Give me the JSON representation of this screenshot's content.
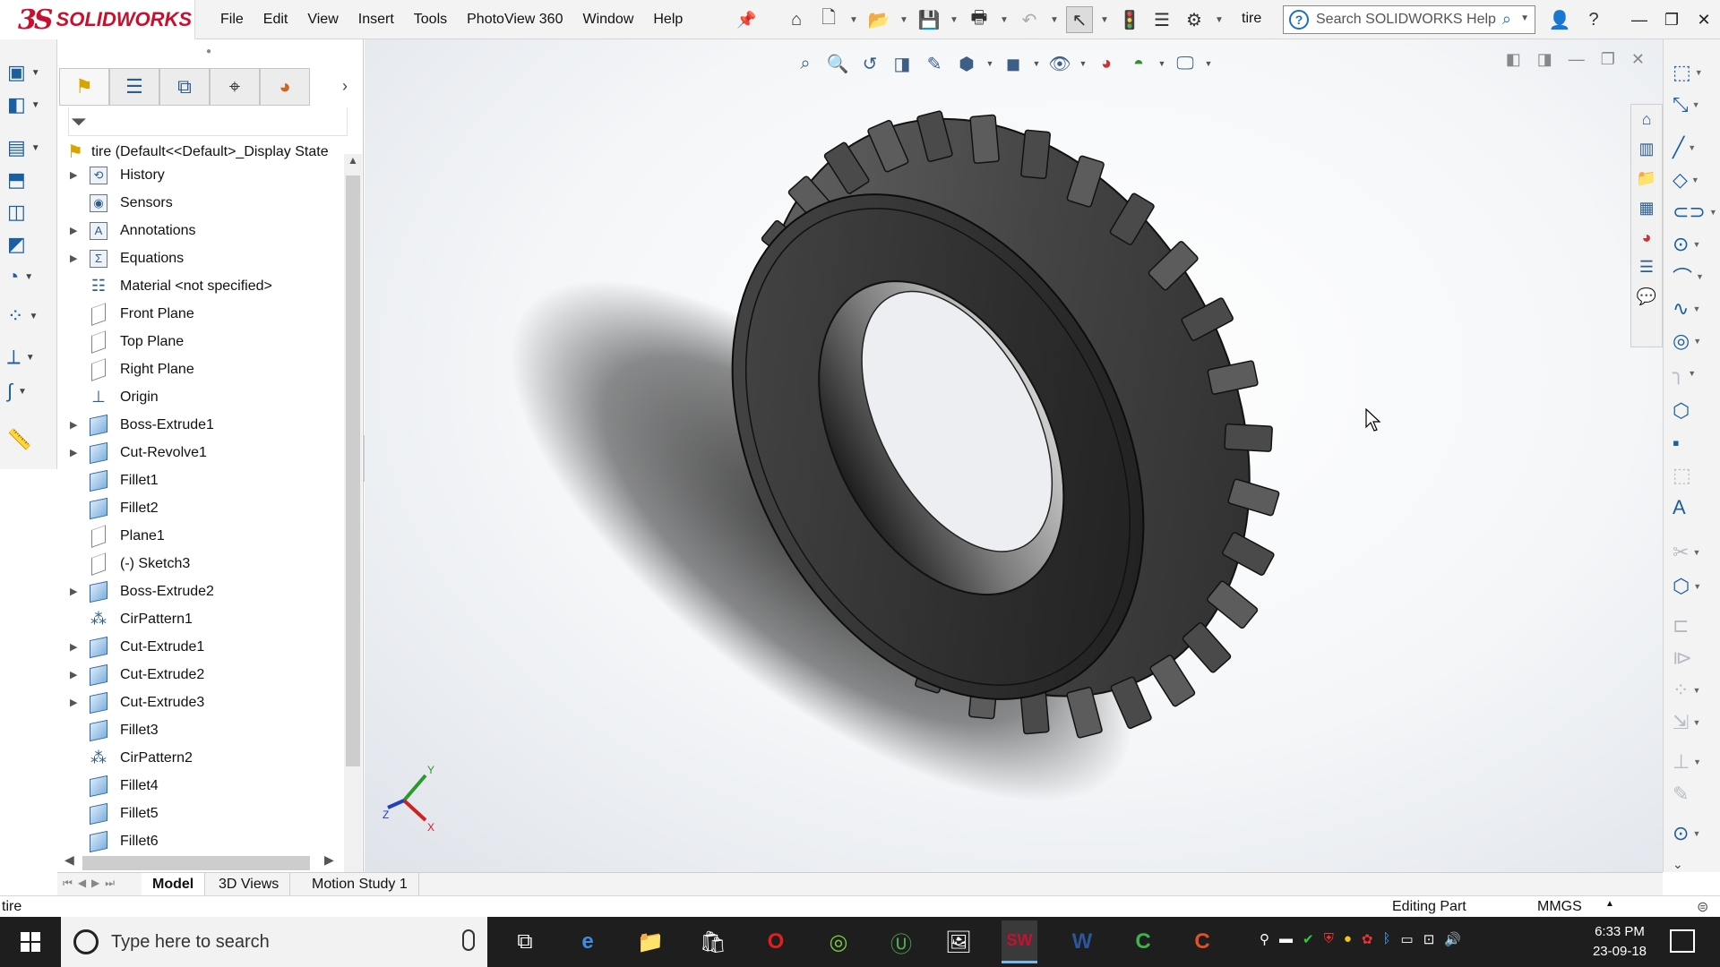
{
  "app": {
    "logo_ds": "3S",
    "logo_brand": "SOLIDWORKS",
    "menu": [
      "File",
      "Edit",
      "View",
      "Insert",
      "Tools",
      "PhotoView 360",
      "Window",
      "Help"
    ],
    "doc_title": "tire",
    "help_search_placeholder": "Search SOLIDWORKS Help"
  },
  "feature_tree": {
    "root_label": "tire  (Default<<Default>_Display State",
    "items": [
      {
        "label": "History",
        "icon": "history-icon",
        "expandable": true
      },
      {
        "label": "Sensors",
        "icon": "sensors-icon",
        "expandable": false
      },
      {
        "label": "Annotations",
        "icon": "annotations-icon",
        "expandable": true
      },
      {
        "label": "Equations",
        "icon": "equations-icon",
        "expandable": true
      },
      {
        "label": "Material <not specified>",
        "icon": "material-icon",
        "expandable": false
      },
      {
        "label": "Front Plane",
        "icon": "plane-icon",
        "expandable": false
      },
      {
        "label": "Top Plane",
        "icon": "plane-icon",
        "expandable": false
      },
      {
        "label": "Right Plane",
        "icon": "plane-icon",
        "expandable": false
      },
      {
        "label": "Origin",
        "icon": "origin-icon",
        "expandable": false
      },
      {
        "label": "Boss-Extrude1",
        "icon": "boss-extrude-icon",
        "expandable": true
      },
      {
        "label": "Cut-Revolve1",
        "icon": "cut-revolve-icon",
        "expandable": true
      },
      {
        "label": "Fillet1",
        "icon": "fillet-icon",
        "expandable": false
      },
      {
        "label": "Fillet2",
        "icon": "fillet-icon",
        "expandable": false
      },
      {
        "label": "Plane1",
        "icon": "plane-icon",
        "expandable": false
      },
      {
        "label": "(-) Sketch3",
        "icon": "sketch-icon",
        "expandable": false
      },
      {
        "label": "Boss-Extrude2",
        "icon": "boss-extrude-icon",
        "expandable": true
      },
      {
        "label": "CirPattern1",
        "icon": "circular-pattern-icon",
        "expandable": false
      },
      {
        "label": "Cut-Extrude1",
        "icon": "cut-extrude-icon",
        "expandable": true
      },
      {
        "label": "Cut-Extrude2",
        "icon": "cut-extrude-icon",
        "expandable": true
      },
      {
        "label": "Cut-Extrude3",
        "icon": "cut-extrude-icon",
        "expandable": true
      },
      {
        "label": "Fillet3",
        "icon": "fillet-icon",
        "expandable": false
      },
      {
        "label": "CirPattern2",
        "icon": "circular-pattern-icon",
        "expandable": false
      },
      {
        "label": "Fillet4",
        "icon": "fillet-icon",
        "expandable": false
      },
      {
        "label": "Fillet5",
        "icon": "fillet-icon",
        "expandable": false
      },
      {
        "label": "Fillet6",
        "icon": "fillet-icon",
        "expandable": false
      }
    ]
  },
  "triad": {
    "x": "X",
    "y": "Y",
    "z": "Z"
  },
  "bottom_tabs": [
    "Model",
    "3D Views",
    "Motion Study 1"
  ],
  "status": {
    "left": "tire",
    "mode": "Editing Part",
    "units": "MMGS"
  },
  "taskbar": {
    "search_placeholder": "Type here to search",
    "time": "6:33 PM",
    "date": "23-09-18"
  },
  "colors": {
    "brand": "#c8102e",
    "accent": "#1d6fc4",
    "taskbar": "#1e1e1e"
  }
}
